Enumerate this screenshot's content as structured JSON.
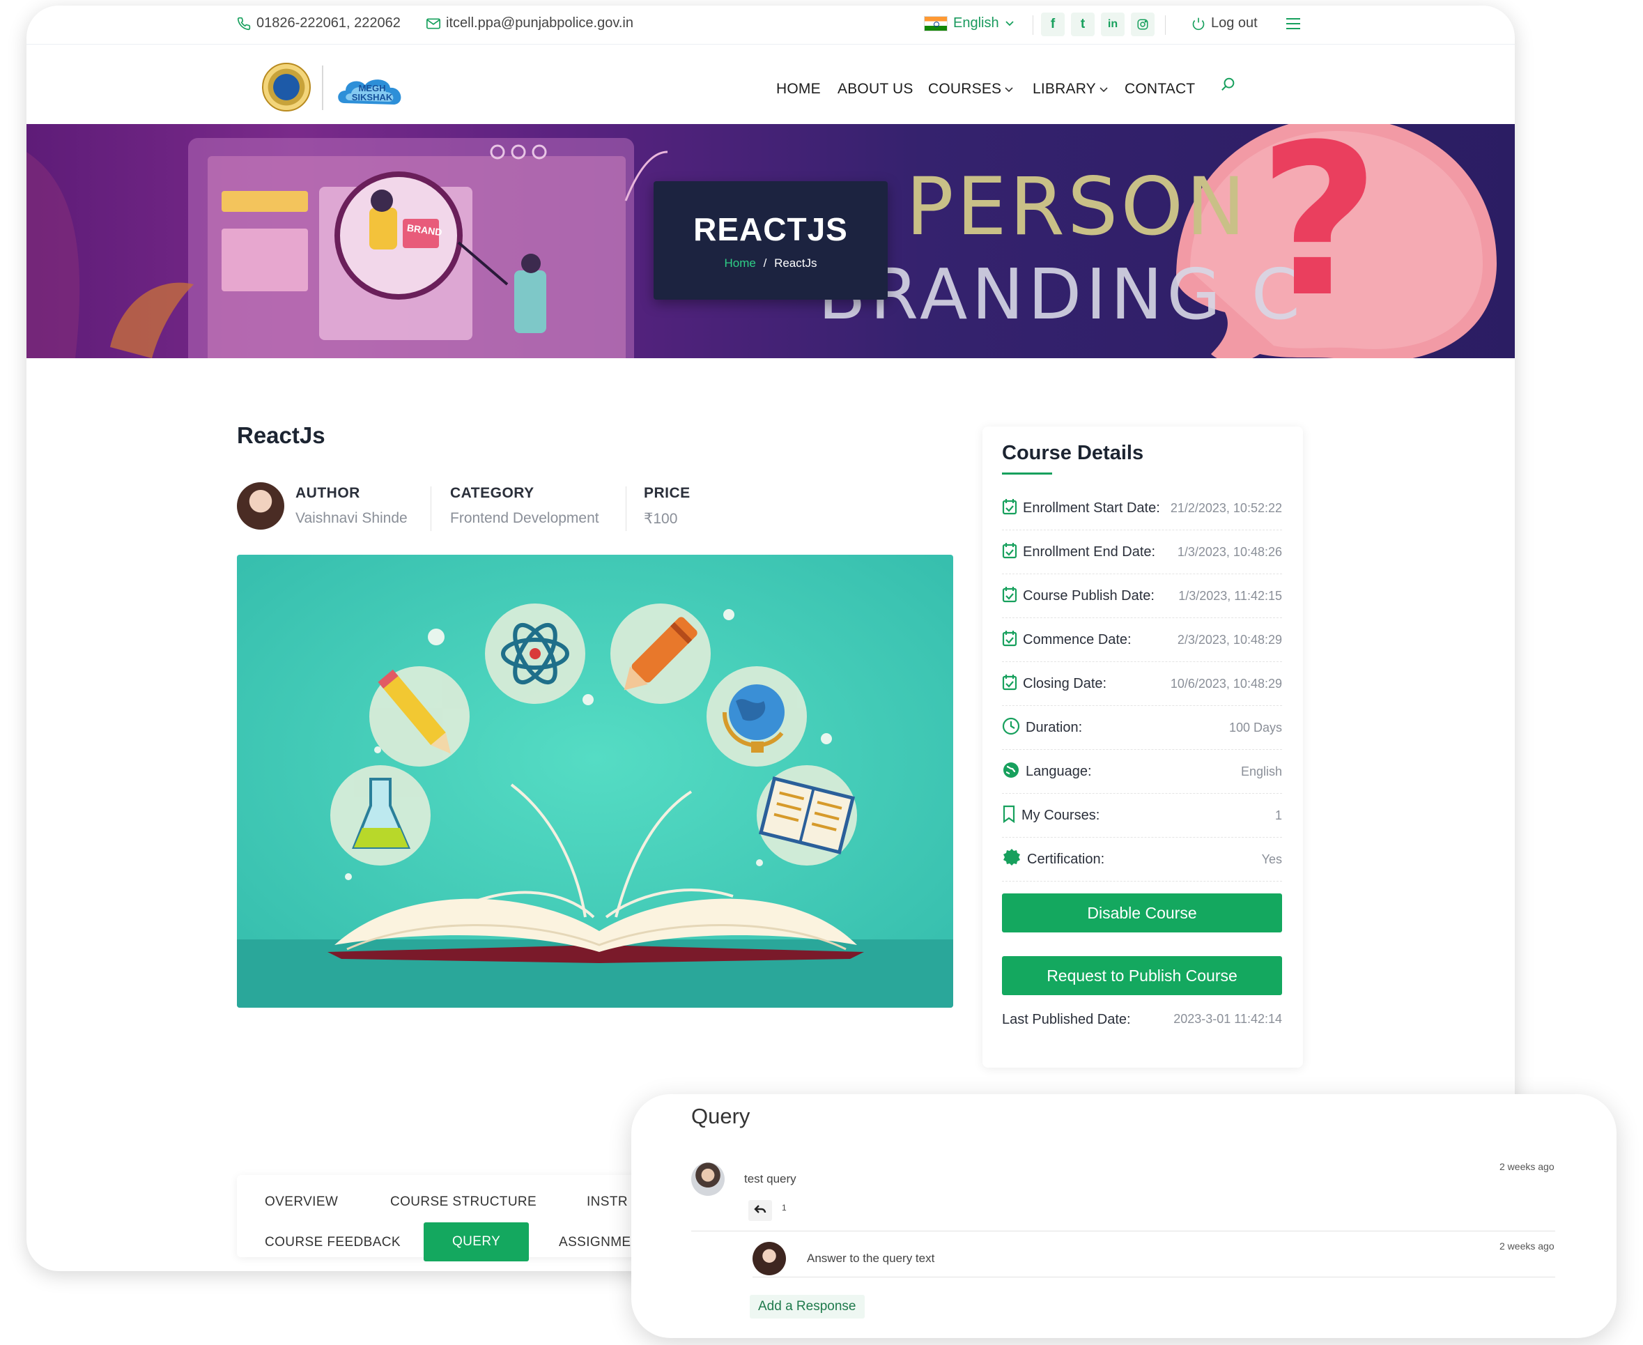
{
  "topbar": {
    "phone": "01826-222061, 222062",
    "email": "itcell.ppa@punjabpolice.gov.in",
    "language": "English",
    "social": [
      "f",
      "t",
      "in",
      "ig"
    ],
    "logout": "Log out"
  },
  "header": {
    "logo_text": "MEGH SIKSHAK",
    "nav": [
      "HOME",
      "ABOUT US",
      "COURSES",
      "LIBRARY",
      "CONTACT"
    ]
  },
  "banner": {
    "title": "REACTJS",
    "breadcrumb_home": "Home",
    "breadcrumb_sep": "/",
    "breadcrumb_current": "ReactJs",
    "bg_word_1": "PERSON",
    "bg_word_2": "BRANDING C",
    "question_mark": "?",
    "brand_sign": "BRAND"
  },
  "course": {
    "name": "ReactJs",
    "author_label": "AUTHOR",
    "author": "Vaishnavi Shinde",
    "category_label": "CATEGORY",
    "category": "Frontend Development",
    "price_label": "PRICE",
    "price": "₹100"
  },
  "details": {
    "title": "Course Details",
    "rows": [
      {
        "label": "Enrollment Start Date:",
        "value": "21/2/2023, 10:52:22",
        "icon": "calendar-icon"
      },
      {
        "label": "Enrollment End Date:",
        "value": "1/3/2023, 10:48:26",
        "icon": "calendar-icon"
      },
      {
        "label": "Course Publish Date:",
        "value": "1/3/2023, 11:42:15",
        "icon": "calendar-icon"
      },
      {
        "label": "Commence Date:",
        "value": "2/3/2023, 10:48:29",
        "icon": "calendar-icon"
      },
      {
        "label": "Closing Date:",
        "value": "10/6/2023, 10:48:29",
        "icon": "calendar-icon"
      },
      {
        "label": "Duration:",
        "value": "100 Days",
        "icon": "clock-icon"
      },
      {
        "label": "Language:",
        "value": "English",
        "icon": "globe-icon"
      },
      {
        "label": "My Courses:",
        "value": "1",
        "icon": "bookmark-icon"
      },
      {
        "label": "Certification:",
        "value": "Yes",
        "icon": "badge-icon"
      }
    ],
    "disable_button": "Disable Course",
    "publish_button": "Request to Publish Course",
    "last_published_label": "Last Published Date:",
    "last_published_value": "2023-3-01 11:42:14"
  },
  "tabs": {
    "row1": [
      "OVERVIEW",
      "COURSE STRUCTURE",
      "INSTR"
    ],
    "row2": [
      "COURSE FEEDBACK",
      "QUERY",
      "ASSIGNMEN"
    ],
    "active": "QUERY"
  },
  "query": {
    "title": "Query",
    "question": {
      "text": "test query",
      "time": "2 weeks ago",
      "reply_count": "1"
    },
    "answer": {
      "text": "Answer to the query text",
      "time": "2 weeks ago"
    },
    "add_response": "Add a Response"
  },
  "colors": {
    "accent": "#14a85f",
    "banner_box": "#1c2340",
    "heading": "#1c2431"
  }
}
